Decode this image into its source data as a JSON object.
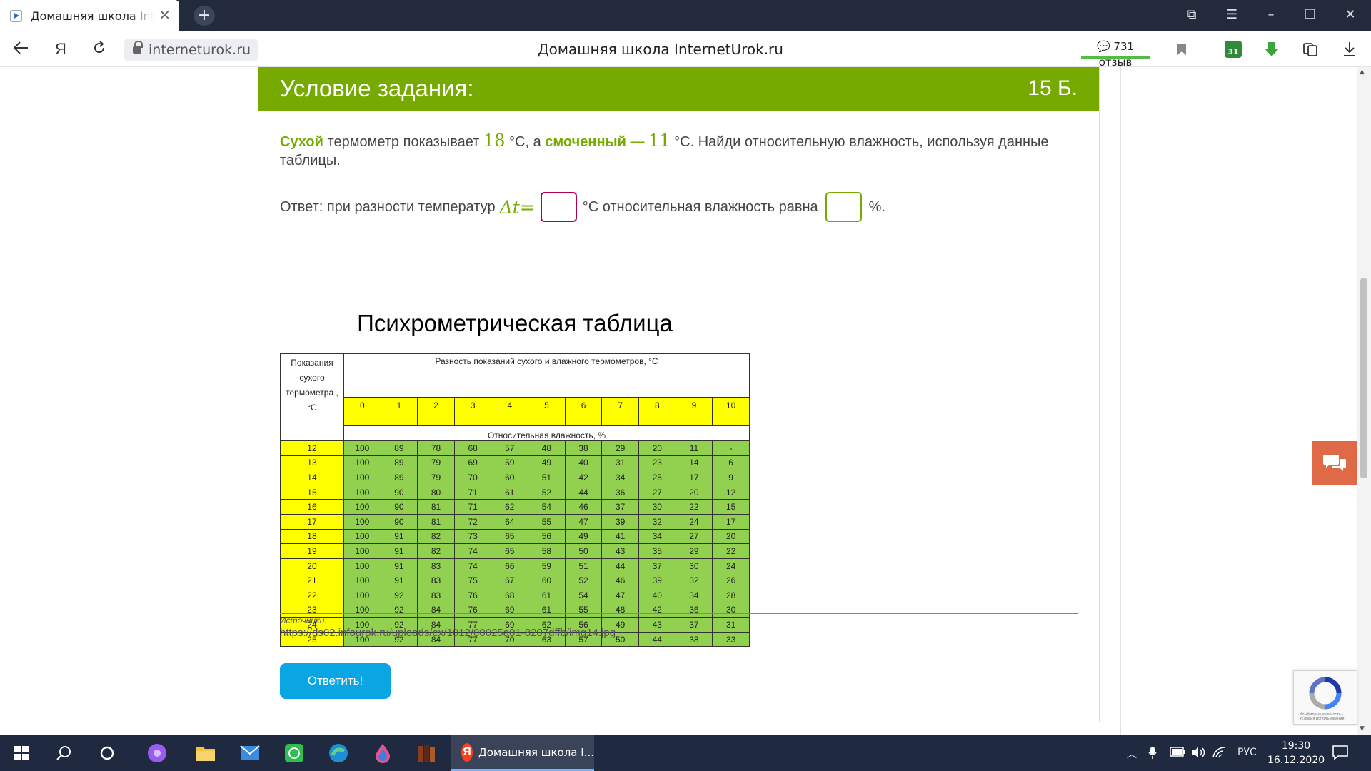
{
  "browser": {
    "tab_title": "Домашняя школа InternetUrok.ru",
    "tab_close": "✕",
    "new_tab": "+",
    "url": "interneturok.ru",
    "page_title": "Домашняя школа InternetUrok.ru",
    "reviews": "731 отзыв",
    "calendar_badge": "31",
    "window_controls": [
      "⧉",
      "☰",
      "–",
      "❐",
      "✕"
    ],
    "nav_yandex": "Я"
  },
  "task": {
    "header_title": "Условие задания:",
    "points": "15 Б.",
    "dry": "Сухой",
    "text1": " термометр показывает ",
    "dry_value": "18",
    "text2": " °C, а ",
    "wet": "смоченный",
    "dash": " — ",
    "wet_value": "11",
    "text3": " °C. Найди относительную влажность, используя данные таблицы.",
    "answer_prefix": "Ответ: при разности температур",
    "delta_symbol": "Δt=",
    "delta_value": "",
    "answer_middle": "°C относительная влажность равна",
    "humidity_value": "",
    "answer_suffix": "%.",
    "sources_label": "Источники:",
    "sources_url": "https://ds02.infourok.ru/uploads/ex/1012/00025a01-8207dffb/img14.jpg",
    "submit_label": "Ответить!"
  },
  "psychrometric": {
    "title": "Психрометрическая таблица",
    "corner_header": "Показания сухого термометра , °C",
    "span_header": "Разность показаний сухого и влажного термометров, °C",
    "sub_header": "Относительная влажность, %",
    "diffs": [
      "0",
      "1",
      "2",
      "3",
      "4",
      "5",
      "6",
      "7",
      "8",
      "9",
      "10"
    ],
    "rows": [
      {
        "t": "12",
        "v": [
          "100",
          "89",
          "78",
          "68",
          "57",
          "48",
          "38",
          "29",
          "20",
          "11",
          "-"
        ]
      },
      {
        "t": "13",
        "v": [
          "100",
          "89",
          "79",
          "69",
          "59",
          "49",
          "40",
          "31",
          "23",
          "14",
          "6"
        ]
      },
      {
        "t": "14",
        "v": [
          "100",
          "89",
          "79",
          "70",
          "60",
          "51",
          "42",
          "34",
          "25",
          "17",
          "9"
        ]
      },
      {
        "t": "15",
        "v": [
          "100",
          "90",
          "80",
          "71",
          "61",
          "52",
          "44",
          "36",
          "27",
          "20",
          "12"
        ]
      },
      {
        "t": "16",
        "v": [
          "100",
          "90",
          "81",
          "71",
          "62",
          "54",
          "46",
          "37",
          "30",
          "22",
          "15"
        ]
      },
      {
        "t": "17",
        "v": [
          "100",
          "90",
          "81",
          "72",
          "64",
          "55",
          "47",
          "39",
          "32",
          "24",
          "17"
        ]
      },
      {
        "t": "18",
        "v": [
          "100",
          "91",
          "82",
          "73",
          "65",
          "56",
          "49",
          "41",
          "34",
          "27",
          "20"
        ]
      },
      {
        "t": "19",
        "v": [
          "100",
          "91",
          "82",
          "74",
          "65",
          "58",
          "50",
          "43",
          "35",
          "29",
          "22"
        ]
      },
      {
        "t": "20",
        "v": [
          "100",
          "91",
          "83",
          "74",
          "66",
          "59",
          "51",
          "44",
          "37",
          "30",
          "24"
        ]
      },
      {
        "t": "21",
        "v": [
          "100",
          "91",
          "83",
          "75",
          "67",
          "60",
          "52",
          "46",
          "39",
          "32",
          "26"
        ]
      },
      {
        "t": "22",
        "v": [
          "100",
          "92",
          "83",
          "76",
          "68",
          "61",
          "54",
          "47",
          "40",
          "34",
          "28"
        ]
      },
      {
        "t": "23",
        "v": [
          "100",
          "92",
          "84",
          "76",
          "69",
          "61",
          "55",
          "48",
          "42",
          "36",
          "30"
        ]
      },
      {
        "t": "24",
        "v": [
          "100",
          "92",
          "84",
          "77",
          "69",
          "62",
          "56",
          "49",
          "43",
          "37",
          "31"
        ]
      },
      {
        "t": "25",
        "v": [
          "100",
          "92",
          "84",
          "77",
          "70",
          "63",
          "57",
          "50",
          "44",
          "38",
          "33"
        ]
      }
    ]
  },
  "recaptcha": {
    "text": "Конфиденциальность - Условия использования"
  },
  "taskbar": {
    "active_app": "Домашняя школа I...",
    "language": "РУС",
    "time": "19:30",
    "date": "16.12.2020"
  }
}
